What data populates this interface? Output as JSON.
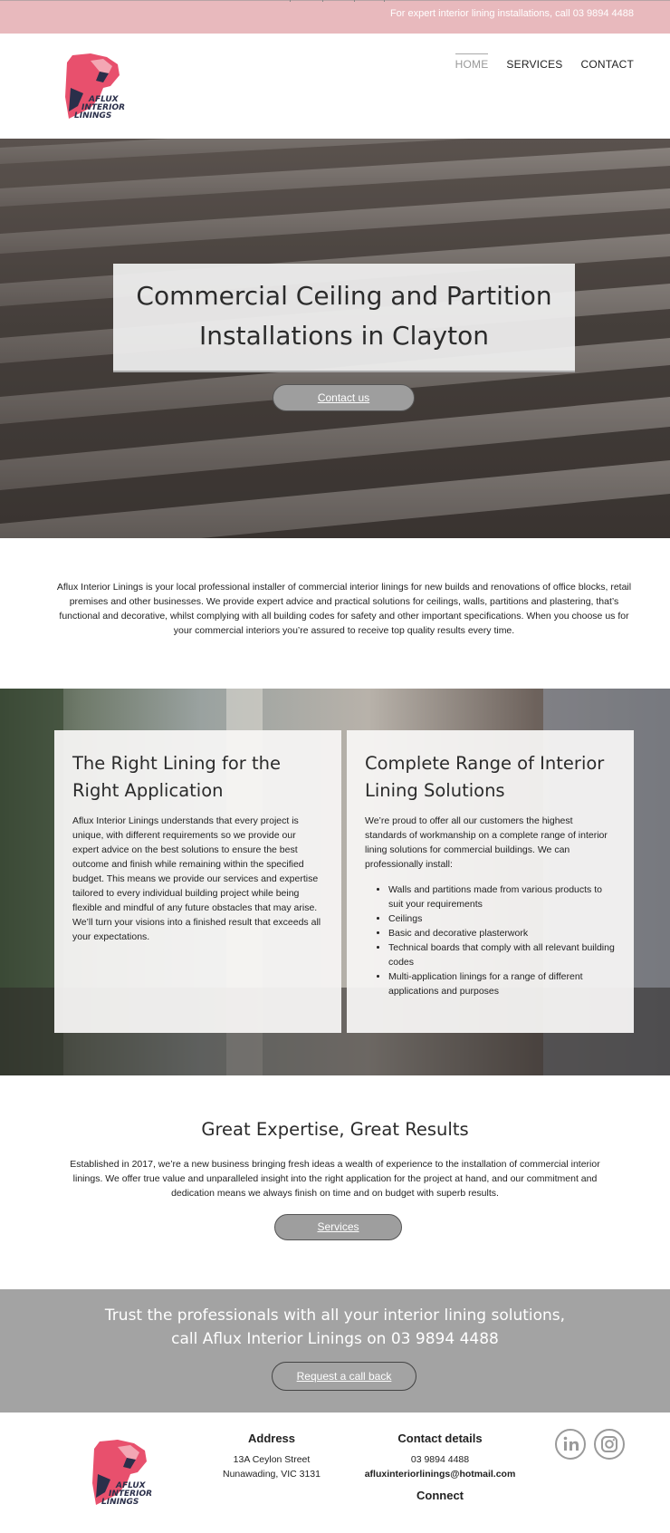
{
  "topbar": {
    "message": "For expert interior lining installations, call 03 9894 4488"
  },
  "brand": {
    "logo_line1": "AFLUX",
    "logo_line2": "INTERIOR",
    "logo_line3": "LININGS",
    "accent": "#e8506d"
  },
  "nav": {
    "items": [
      "HOME",
      "SERVICES",
      "CONTACT"
    ],
    "active": "HOME"
  },
  "hero": {
    "title": "Commercial Ceiling and Partition Installations in Clayton",
    "button": "Contact us"
  },
  "intro": "Aflux Interior Linings is your local professional installer of commercial interior linings for new builds and renovations of office blocks, retail premises and other businesses. We provide expert advice and practical solutions for ceilings, walls, partitions and plastering, that’s functional and decorative, whilst complying with all building codes for safety and other important specifications. When you choose us for your commercial interiors you’re assured to receive top quality results every time.",
  "features": {
    "left": {
      "title": "The Right Lining for the Right Application",
      "body": "Aflux Interior Linings understands that every project is unique, with different requirements so we provide our expert advice on the best solutions to ensure the best outcome and finish while remaining within the specified budget. This means we provide our services and expertise tailored to every individual building project while being flexible and mindful of any future obstacles that may arise. We’ll turn your visions into a finished result that exceeds all your expectations."
    },
    "right": {
      "title": "Complete Range of Interior Lining Solutions",
      "body": "We’re proud to offer all our customers the highest standards of workmanship on a complete range of interior lining solutions for commercial buildings. We can professionally install:",
      "list": [
        "Walls and partitions made from various products to suit your requirements",
        "Ceilings",
        "Basic and decorative plasterwork",
        "Technical boards that comply with all relevant building codes",
        "Multi-application linings for a range of different applications and purposes"
      ]
    }
  },
  "expertise": {
    "title": "Great Expertise, Great Results",
    "body": "Established in 2017, we’re a new business bringing fresh ideas a wealth of experience to the installation of commercial interior linings. We offer true value and unparalleled insight into the right application for the project at hand, and our commitment and dedication means we always finish on time and on budget with superb results.",
    "button": "Services"
  },
  "cta": {
    "title": "Trust the professionals with all your interior lining solutions, call Aflux Interior Linings on 03 9894 4488",
    "button": "Request a call back"
  },
  "footer": {
    "address_heading": "Address",
    "address_line1": "13A Ceylon Street",
    "address_line2": "Nunawading, VIC 3131",
    "contact_heading": "Contact details",
    "phone": "03 9894 4488",
    "email": "afluxinteriorlinings@hotmail.com",
    "connect_heading": "Connect",
    "social": [
      "linkedin-icon",
      "instagram-icon"
    ]
  }
}
